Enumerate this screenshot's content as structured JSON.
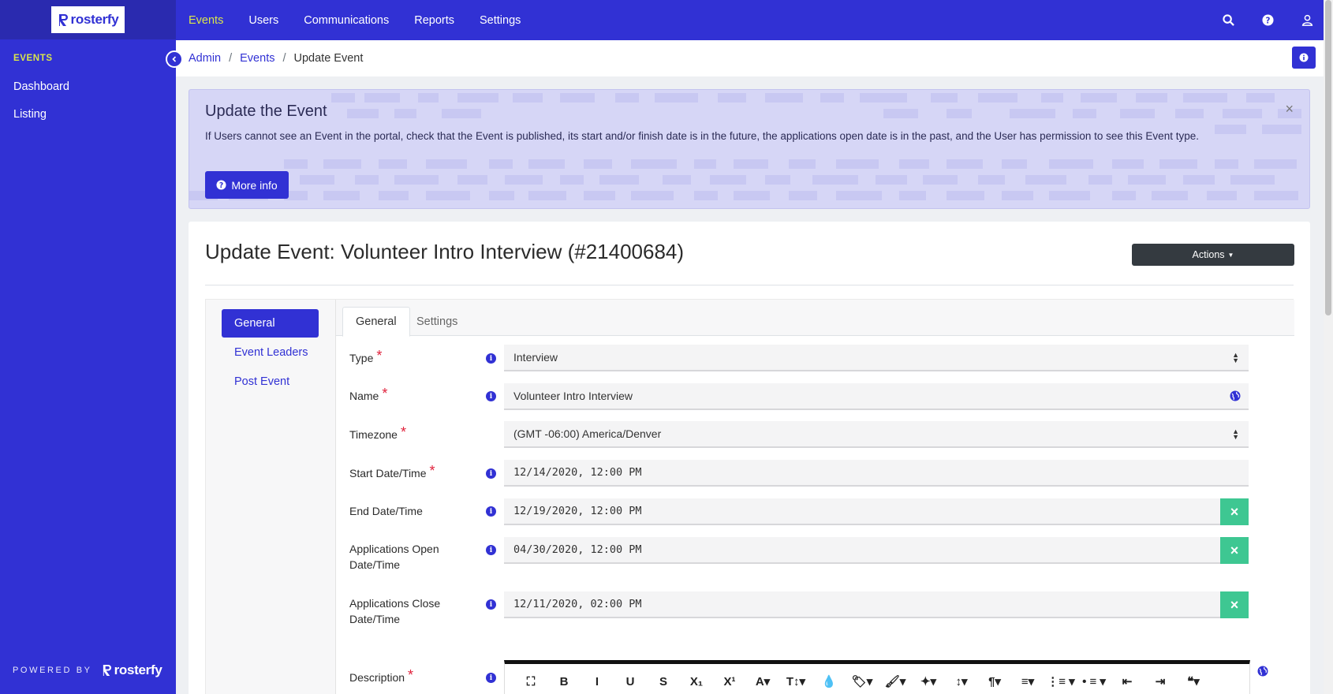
{
  "app": {
    "logo_text": "rosterfy",
    "brand_color": "#3131d4",
    "accent_color": "#d9e64b"
  },
  "topnav": {
    "items": [
      "Events",
      "Users",
      "Communications",
      "Reports",
      "Settings"
    ],
    "active": "Events",
    "icons": [
      "search-icon",
      "help-icon",
      "user-icon"
    ]
  },
  "sidebar": {
    "section": "EVENTS",
    "items": [
      "Dashboard",
      "Listing"
    ],
    "powered_by": "POWERED BY",
    "powered_logo": "rosterfy"
  },
  "breadcrumb": {
    "items": [
      "Admin",
      "Events"
    ],
    "current": "Update Event"
  },
  "alert": {
    "title": "Update the Event",
    "text": "If Users cannot see an Event in the portal, check that the Event is published, its start and/or finish date is in the future, the applications open date is in the past, and the User has permission to see this Event type.",
    "button": "More info",
    "close": "×"
  },
  "page": {
    "title": "Update Event: Volunteer Intro Interview (#21400684)",
    "actions_label": "Actions"
  },
  "subnav": {
    "items": [
      "General",
      "Event Leaders",
      "Post Event"
    ],
    "active": "General"
  },
  "tabs": {
    "items": [
      "General",
      "Settings"
    ],
    "active": "General"
  },
  "form": {
    "type": {
      "label": "Type",
      "value": "Interview",
      "required": true
    },
    "name": {
      "label": "Name",
      "value": "Volunteer Intro Interview",
      "required": true
    },
    "timezone": {
      "label": "Timezone",
      "value": "(GMT -06:00) America/Denver",
      "required": true
    },
    "start": {
      "label": "Start Date/Time",
      "value": "12/14/2020, 12:00 PM",
      "required": true
    },
    "end": {
      "label": "End Date/Time",
      "value": "12/19/2020, 12:00 PM"
    },
    "apps_open": {
      "label_line1": "Applications Open",
      "label_line2": "Date/Time",
      "value": "04/30/2020, 12:00 PM"
    },
    "apps_close": {
      "label_line1": "Applications Close",
      "label_line2": "Date/Time",
      "value": "12/11/2020, 02:00 PM"
    },
    "description": {
      "label": "Description",
      "required": true
    }
  },
  "editor_toolbar": [
    {
      "name": "fullscreen-icon",
      "glyph": "⛶"
    },
    {
      "name": "bold-icon",
      "glyph": "B"
    },
    {
      "name": "italic-icon",
      "glyph": "I"
    },
    {
      "name": "underline-icon",
      "glyph": "U"
    },
    {
      "name": "strikethrough-icon",
      "glyph": "S"
    },
    {
      "name": "subscript-icon",
      "glyph": "X₁"
    },
    {
      "name": "superscript-icon",
      "glyph": "X¹"
    },
    {
      "name": "font-family-icon",
      "glyph": "A▾"
    },
    {
      "name": "font-size-icon",
      "glyph": "T↕▾"
    },
    {
      "name": "color-drop-icon",
      "glyph": "💧"
    },
    {
      "name": "tag-icon",
      "glyph": "🏷▾"
    },
    {
      "name": "brush-icon",
      "glyph": "🖌▾"
    },
    {
      "name": "magic-icon",
      "glyph": "✦▾"
    },
    {
      "name": "line-height-icon",
      "glyph": "↕▾"
    },
    {
      "name": "paragraph-icon",
      "glyph": "¶▾"
    },
    {
      "name": "align-icon",
      "glyph": "≡▾"
    },
    {
      "name": "ordered-list-icon",
      "glyph": "⋮≡ ▾"
    },
    {
      "name": "unordered-list-icon",
      "glyph": "• ≡ ▾"
    },
    {
      "name": "outdent-icon",
      "glyph": "⇤"
    },
    {
      "name": "indent-icon",
      "glyph": "⇥"
    },
    {
      "name": "quote-icon",
      "glyph": "❝▾"
    }
  ]
}
